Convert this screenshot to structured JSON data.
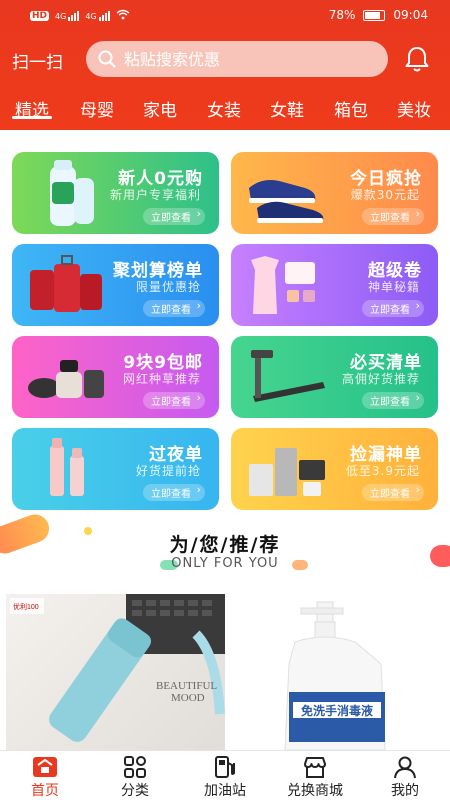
{
  "status_bar": {
    "left_badges": [
      "HD",
      "4G",
      "4G"
    ],
    "battery": "78%",
    "time": "09:04"
  },
  "header": {
    "scan_label": "扫一扫",
    "search_placeholder": "粘贴搜索优惠",
    "bell_icon": "bell-icon"
  },
  "tabs": [
    {
      "label": "精选",
      "active": true
    },
    {
      "label": "母婴",
      "active": false
    },
    {
      "label": "家电",
      "active": false
    },
    {
      "label": "女装",
      "active": false
    },
    {
      "label": "女鞋",
      "active": false
    },
    {
      "label": "箱包",
      "active": false
    },
    {
      "label": "美妆",
      "active": false
    }
  ],
  "cards": [
    {
      "title": "新人0元购",
      "subtitle": "新用户专享福利",
      "button": "立即查看"
    },
    {
      "title": "今日疯抢",
      "subtitle": "爆款30元起",
      "button": "立即查看"
    },
    {
      "title": "聚划算榜单",
      "subtitle": "限量优惠抢",
      "button": "立即查看"
    },
    {
      "title": "超级卷",
      "subtitle": "神单秘籍",
      "button": "立即查看"
    },
    {
      "title": "9块9包邮",
      "subtitle": "网红种草推荐",
      "button": "立即查看"
    },
    {
      "title": "必买清单",
      "subtitle": "高佣好货推荐",
      "button": "立即查看"
    },
    {
      "title": "过夜单",
      "subtitle": "好货提前抢",
      "button": "立即查看"
    },
    {
      "title": "捡漏神单",
      "subtitle": "低至3.9元起",
      "button": "立即查看"
    }
  ],
  "recommend": {
    "title": "为/您/推/荐",
    "subtitle": "ONLY FOR YOU"
  },
  "products": [
    {
      "image_text": [
        "BEAUTIFUL",
        "MOOD"
      ],
      "badge": "优利100"
    },
    {
      "image_text": [
        "免洗手消毒液"
      ]
    }
  ],
  "bottom_nav": [
    {
      "label": "首页",
      "icon": "home-icon",
      "active": true
    },
    {
      "label": "分类",
      "icon": "category-icon",
      "active": false
    },
    {
      "label": "加油站",
      "icon": "gas-station-icon",
      "active": false
    },
    {
      "label": "兑换商城",
      "icon": "store-icon",
      "active": false
    },
    {
      "label": "我的",
      "icon": "profile-icon",
      "active": false
    }
  ],
  "colors": {
    "brand_red": "#e8381f",
    "search_bg": "#f8c4b9"
  }
}
